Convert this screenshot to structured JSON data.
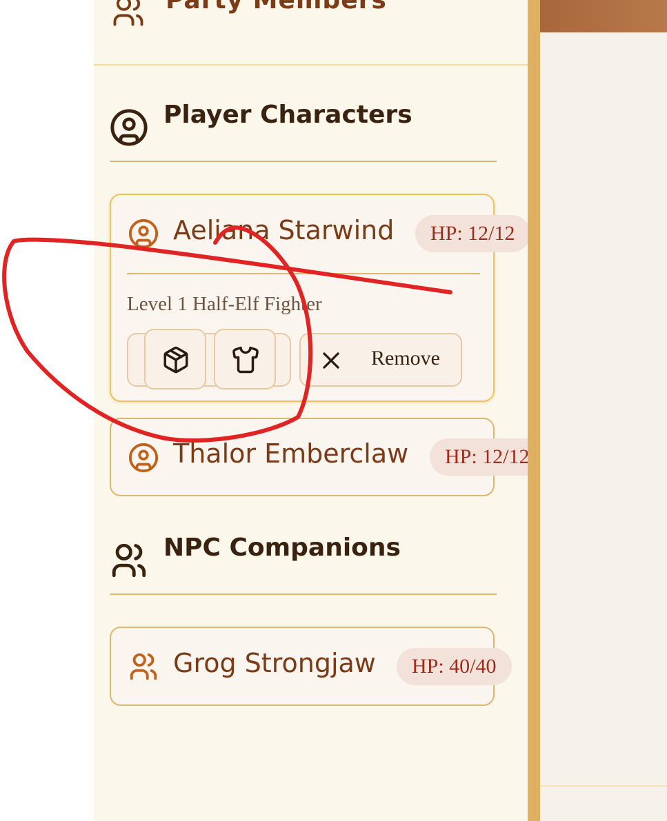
{
  "panel": {
    "title": "Party Members"
  },
  "player_section": {
    "title": "Player Characters",
    "characters": [
      {
        "name": "Aeliana Starwind",
        "hp": "HP: 12/12",
        "description": "Level 1 Half-Elf Fighter",
        "actions": {
          "inventory_icon": "package-icon",
          "equipment_icon": "shirt-icon",
          "remove_label": "Remove"
        }
      },
      {
        "name": "Thalor Emberclaw",
        "hp": "HP: 12/12"
      }
    ]
  },
  "npc_section": {
    "title": "NPC Companions",
    "companions": [
      {
        "name": "Grog Strongjaw",
        "hp": "HP: 40/40"
      }
    ]
  },
  "colors": {
    "panel_bg": "#fbf7ea",
    "accent_brown": "#7a3b16",
    "border_gold": "#dfb670",
    "hp_red": "#a12b1b",
    "annotation_red": "#e02424"
  }
}
